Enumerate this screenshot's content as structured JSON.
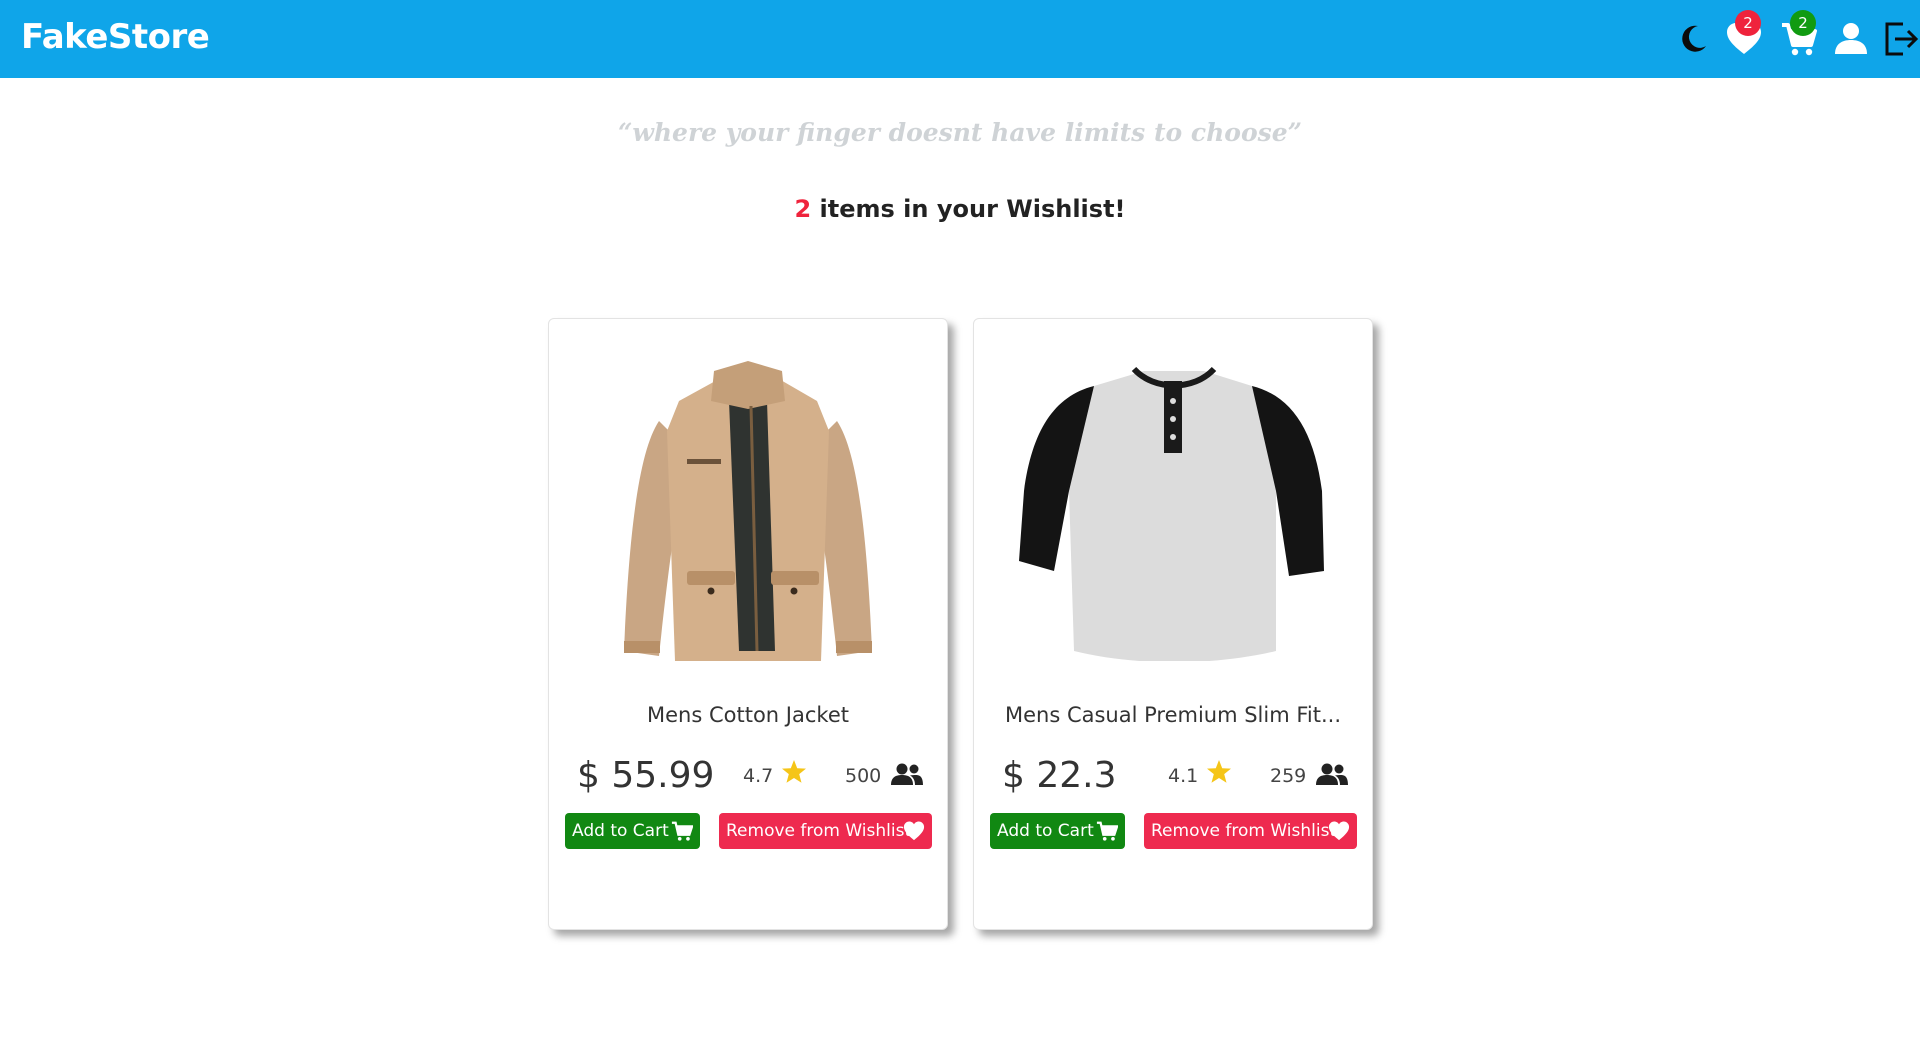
{
  "app": {
    "brand": "FakeStore",
    "header_color": "#0fa5e9"
  },
  "nav": {
    "theme_icon": "moon-icon",
    "wishlist_icon": "heart-icon",
    "wishlist_count": "2",
    "cart_icon": "cart-icon",
    "cart_count": "2",
    "user_icon": "user-icon",
    "logout_icon": "logout-icon"
  },
  "hero": {
    "tagline": "“where your finger doesnt have limits to choose”",
    "count": "2",
    "count_suffix": " items in your Wishlist!"
  },
  "products": [
    {
      "title": "Mens Cotton Jacket",
      "price": "$ 55.99",
      "rating": "4.7",
      "reviews": "500",
      "image": "jacket-image",
      "add_to_cart": "Add to Cart",
      "remove_from_wishlist": "Remove from Wishlist"
    },
    {
      "title": "Mens Casual Premium Slim Fit...",
      "price": "$ 22.3",
      "rating": "4.1",
      "reviews": "259",
      "image": "raglan-tshirt-image",
      "add_to_cart": "Add to Cart",
      "remove_from_wishlist": "Remove from Wishlist"
    }
  ],
  "colors": {
    "accent_red": "#ef233c",
    "cart_green": "#118812",
    "star_gold": "#f5c518"
  }
}
